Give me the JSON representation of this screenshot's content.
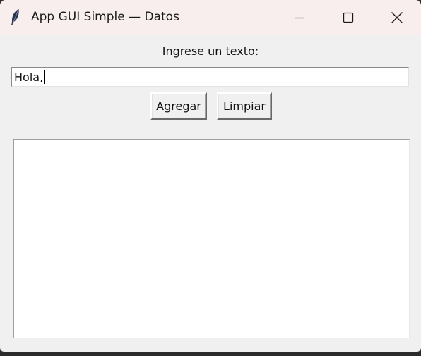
{
  "window": {
    "title": "App GUI Simple — Datos",
    "controls": {
      "minimize": "minimize",
      "maximize": "maximize",
      "close": "close"
    },
    "icon": "feather-icon"
  },
  "form": {
    "prompt_label": "Ingrese un texto:",
    "entry_value": "Hola,",
    "add_button_label": "Agregar",
    "clear_button_label": "Limpiar"
  },
  "listbox": {
    "items": []
  },
  "colors": {
    "titlebar_bg": "#f8eeee",
    "window_bg": "#f0f0f0",
    "field_bg": "#ffffff"
  }
}
